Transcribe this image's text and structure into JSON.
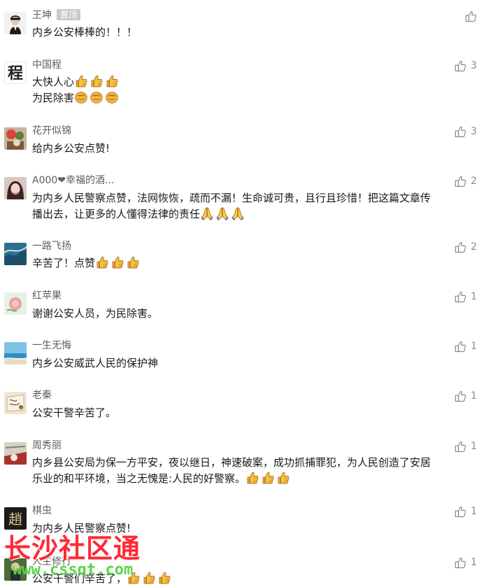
{
  "icons": {
    "like": "thumbs-up-outline-icon",
    "emoji_thumb": "thumbs-up-emoji",
    "emoji_fist": "fist-emoji",
    "emoji_pray": "folded-hands-emoji"
  },
  "colors": {
    "nickname": "#5e5e5e",
    "pin_badge_bg": "#c9c9c9",
    "like_icon": "#8a8a8a",
    "watermark_red": "#ff2a35",
    "watermark_green": "#5bd44c"
  },
  "comments": [
    {
      "nickname": "王坤",
      "badge": "置顶",
      "lines": [
        "内乡公安棒棒的！！！"
      ],
      "likes": ""
    },
    {
      "nickname": "中国程",
      "lines": [
        "大快人心",
        "为民除害"
      ],
      "likes": "3"
    },
    {
      "nickname": "花开似锦",
      "lines": [
        "给内乡公安点赞!"
      ],
      "likes": "3"
    },
    {
      "nickname": "A000❤幸福的酒...",
      "lines": [
        "为内乡人民警察点赞，法网恢恢，疏而不漏！生命诚可贵，且行且珍惜！把这篇文章传",
        "播出去，让更多的人懂得法律的责任"
      ],
      "likes": "2"
    },
    {
      "nickname": "一路飞扬",
      "lines": [
        "辛苦了！点赞"
      ],
      "likes": "2"
    },
    {
      "nickname": "红苹果",
      "lines": [
        "谢谢公安人员，为民除害。"
      ],
      "likes": "1"
    },
    {
      "nickname": "一生无悔",
      "lines": [
        "内乡公安威武人民的保护神"
      ],
      "likes": "1"
    },
    {
      "nickname": "老秦",
      "lines": [
        "公安干警辛苦了。"
      ],
      "likes": "1"
    },
    {
      "nickname": "周秀丽",
      "lines": [
        "内乡县公安局为保一方平安，夜以继日，神速破案，成功抓捕罪犯，为人民创造了安居",
        "乐业的和平环境，当之无愧是:人民的好警察。"
      ],
      "likes": "1"
    },
    {
      "nickname": "棋虫",
      "lines": [
        "为内乡人民警察点赞!"
      ],
      "likes": "1"
    },
    {
      "nickname": "人生修行",
      "lines": [
        "公安干警们辛苦了，"
      ],
      "likes": "1"
    }
  ],
  "avatars": {
    "c2_glyph": "程",
    "c10_glyph": "趙"
  },
  "watermark": {
    "title": "长沙社区通",
    "url": "www.cssqt.com"
  }
}
